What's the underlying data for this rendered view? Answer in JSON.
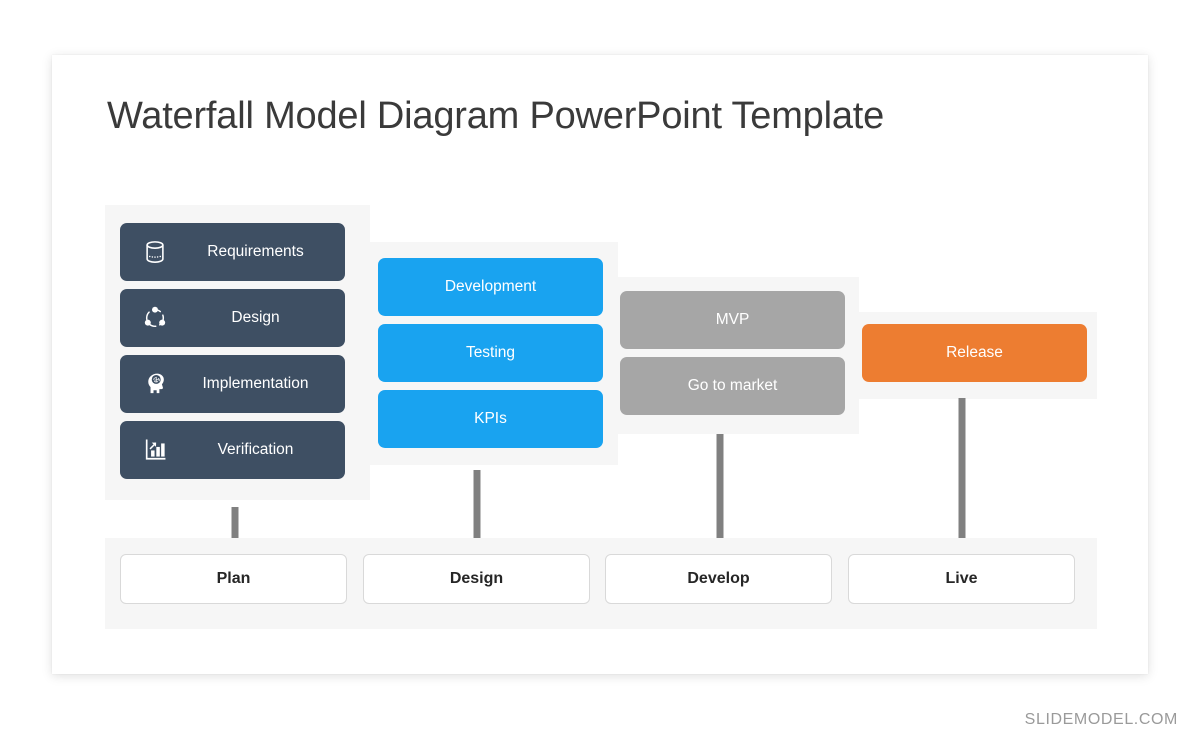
{
  "slide": {
    "title": "Waterfall Model Diagram PowerPoint Template"
  },
  "watermark": {
    "text": "SLIDEMODEL.COM"
  },
  "colors": {
    "dark": "#3e4f63",
    "blue": "#19a3f0",
    "gray": "#a6a6a6",
    "orange": "#ed7d31",
    "panel": "#f6f6f6",
    "arrow": "#808080",
    "title_text": "#3a3a3a",
    "bottom_text": "#262626"
  },
  "phases": [
    {
      "key": "plan",
      "color": "#3e4f63",
      "cards": [
        {
          "label": "Requirements",
          "icon": "database-icon"
        },
        {
          "label": "Design",
          "icon": "share-network-icon"
        },
        {
          "label": "Implementation",
          "icon": "brain-head-icon"
        },
        {
          "label": "Verification",
          "icon": "bar-chart-growth-icon"
        }
      ],
      "outcome": "Plan"
    },
    {
      "key": "design",
      "color": "#19a3f0",
      "cards": [
        {
          "label": "Development",
          "icon": ""
        },
        {
          "label": "Testing",
          "icon": ""
        },
        {
          "label": "KPIs",
          "icon": ""
        }
      ],
      "outcome": "Design"
    },
    {
      "key": "develop",
      "color": "#a6a6a6",
      "cards": [
        {
          "label": "MVP",
          "icon": ""
        },
        {
          "label": "Go to market",
          "icon": ""
        }
      ],
      "outcome": "Develop"
    },
    {
      "key": "live",
      "color": "#ed7d31",
      "cards": [
        {
          "label": "Release",
          "icon": ""
        }
      ],
      "outcome": "Live"
    }
  ]
}
